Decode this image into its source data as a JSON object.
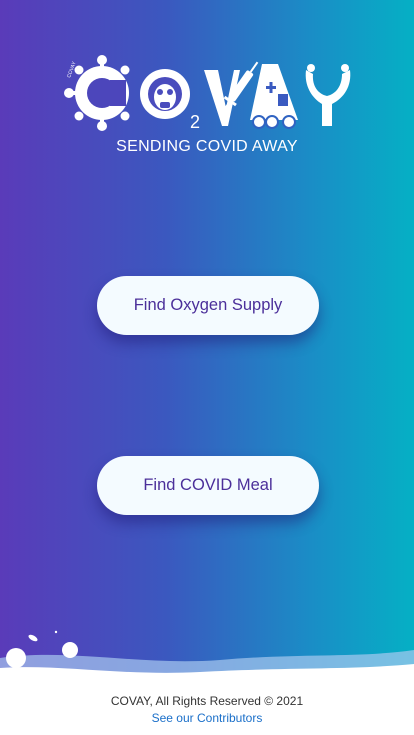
{
  "brand": {
    "logo_text": "COVAY",
    "ring_text": "COVAY",
    "o2_label": "2",
    "tagline": "SENDING COVID AWAY"
  },
  "actions": {
    "oxygen_label": "Find Oxygen Supply",
    "meal_label": "Find COVID Meal"
  },
  "footer": {
    "rights": "COVAY, All Rights Reserved © 2021",
    "contributors_link": "See our Contributors"
  },
  "colors": {
    "gradient_start": "#5a3bb9",
    "gradient_end": "#05b0c5",
    "button_bg": "#f4fbff",
    "button_text": "#4b2f9a",
    "link": "#1a6fc9"
  },
  "icons": [
    "virus-icon",
    "gas-mask-icon",
    "syringe-icon",
    "ambulance-robot-icon",
    "hands-icon"
  ]
}
